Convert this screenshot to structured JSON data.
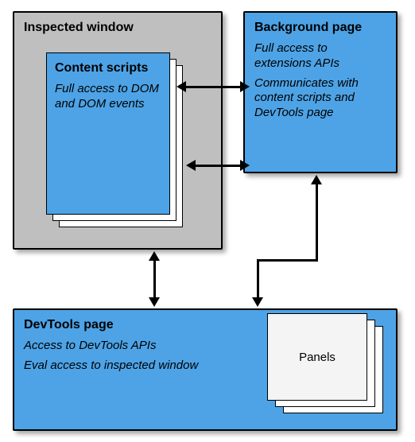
{
  "inspected": {
    "title": "Inspected window"
  },
  "contentScripts": {
    "title": "Content scripts",
    "desc": "Full access to DOM and DOM events"
  },
  "backgroundPage": {
    "title": "Background page",
    "desc1": "Full access to extensions APIs",
    "desc2": "Communicates with content scripts and DevTools page"
  },
  "devtools": {
    "title": "DevTools page",
    "desc1": "Access to DevTools APIs",
    "desc2": "Eval access to inspected window"
  },
  "panels": {
    "label": "Panels"
  }
}
